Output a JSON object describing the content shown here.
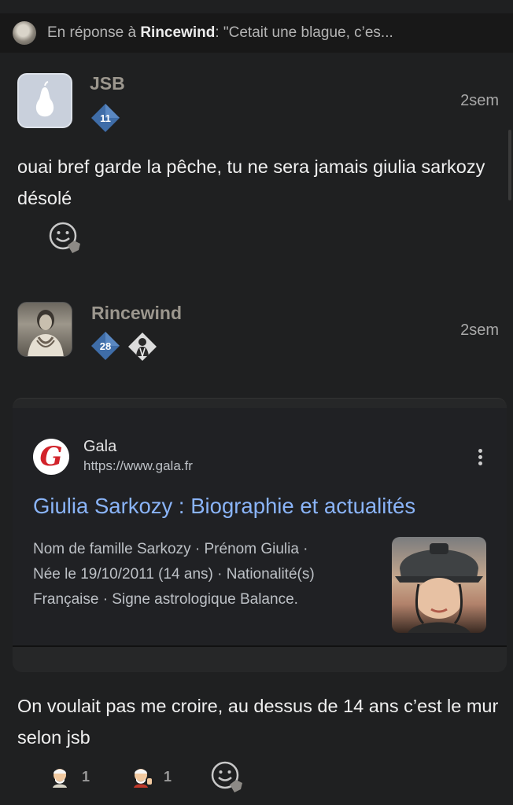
{
  "reply": {
    "prefix": "En réponse à ",
    "user": "Rincewind",
    "quote": ": \"Cetait une blague, c’es..."
  },
  "post1": {
    "username": "JSB",
    "level": "11",
    "time": "2sem",
    "message": "ouai bref garde la pêche, tu ne sera jamais giulia sarkozy désolé",
    "avatar_icon": "pear-icon"
  },
  "post2": {
    "username": "Rincewind",
    "level": "28",
    "time": "2sem",
    "message": "On voulait pas me croire, au dessus de 14 ans c’est le mur selon jsb",
    "reactions": [
      {
        "emoji": "old-man-emoji",
        "count": "1"
      },
      {
        "emoji": "old-man-thumbs-up-emoji",
        "count": "1"
      }
    ]
  },
  "card": {
    "site_letter": "G",
    "site_name": "Gala",
    "site_url": "https://www.gala.fr",
    "title": "Giulia Sarkozy : Biographie et actualités",
    "snippet_lines": [
      "Nom de famille Sarkozy · Prénom Giulia ·",
      "Née le 19/10/2011 (14 ans) · Nationalité(s)",
      "Française · Signe astrologique Balance."
    ]
  },
  "colors": {
    "background": "#1f2021",
    "link_blue": "#8ab4f8",
    "badge_blue": "#3f6da8",
    "username_gray": "#9c978e"
  }
}
